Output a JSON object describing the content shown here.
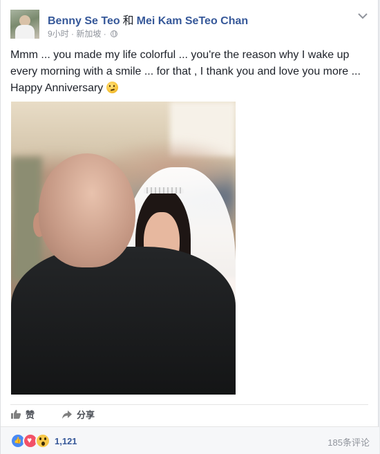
{
  "post": {
    "author_primary": "Benny Se Teo",
    "connector": "和",
    "author_secondary": "Mei Kam SeTeo Chan",
    "time": "9小时",
    "location": "新加坡",
    "separator": "·",
    "message": "Mmm ... you made my life colorful ... you're the reason why I wake up every morning with a smile ... for that , I thank you and love you more ... Happy Anniversary",
    "icons": {
      "menu": "chevron-down-icon",
      "privacy": "globe-icon",
      "emoji": "thinking-face-icon"
    }
  },
  "actions": {
    "like_label": "赞",
    "share_label": "分享"
  },
  "footer": {
    "reaction_count": "1,121",
    "comments_label": "185条评论",
    "reactions": [
      "like",
      "love",
      "wow"
    ]
  },
  "colors": {
    "link": "#365899",
    "meta": "#90949c",
    "text": "#1d2129"
  }
}
